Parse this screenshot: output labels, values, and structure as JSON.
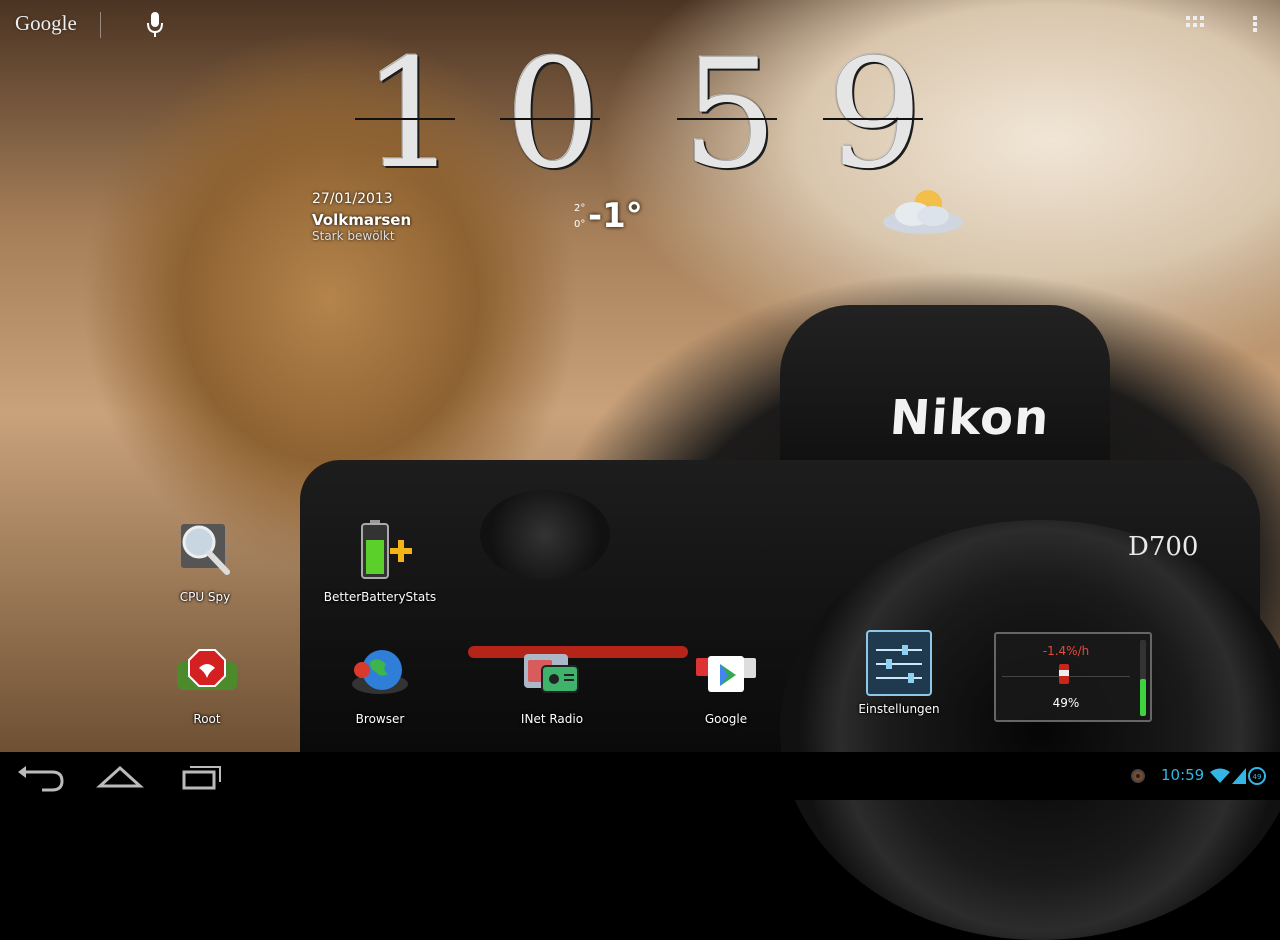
{
  "search": {
    "brand": "Google"
  },
  "clock": {
    "d1": "1",
    "d2": "0",
    "d3": "5",
    "d4": "9"
  },
  "weather": {
    "date": "27/01/2013",
    "city": "Volkmarsen",
    "condition": "Stark bewölkt",
    "temp_high": "2°",
    "temp_low": "0°",
    "temperature": "-1°"
  },
  "wallpaper": {
    "brand": "Nikon",
    "model": "D700"
  },
  "apps": [
    {
      "label": "CPU Spy",
      "icon": "cpu-magnifier-icon"
    },
    {
      "label": "BetterBatteryStats",
      "icon": "battery-plus-icon"
    },
    {
      "label": "Root",
      "icon": "root-stop-sign-icon"
    },
    {
      "label": "Browser",
      "icon": "globe-icon"
    },
    {
      "label": "INet Radio",
      "icon": "radio-icon"
    },
    {
      "label": "Google",
      "icon": "google-folder-icon"
    },
    {
      "label": "Einstellungen",
      "icon": "settings-sliders-icon"
    }
  ],
  "battery_widget": {
    "rate": "-1.4%/h",
    "percent": "49%",
    "level": 0.49
  },
  "status_bar": {
    "time": "10:59",
    "battery_badge": "49"
  },
  "colors": {
    "accent": "#33b5e5",
    "battery_green": "#3fd23f",
    "rate_red": "#e04a3a"
  }
}
